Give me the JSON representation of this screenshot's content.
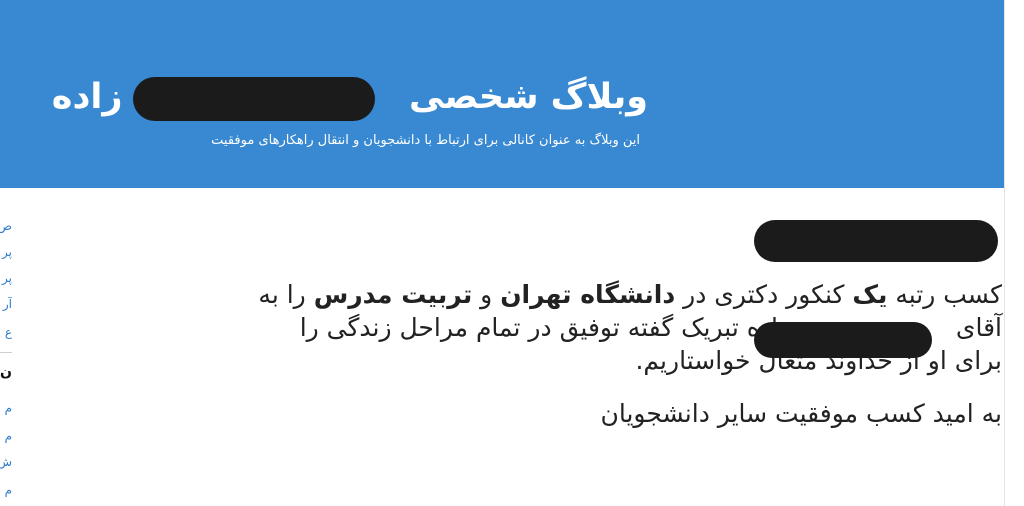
{
  "header": {
    "title_prefix": "وبلاگ شخصی",
    "title_suffix": "زاده",
    "tagline": "این وبلاگ به عنوان کانالی برای ارتباط با دانشجویان و انتقال راهکارهای موفقیت"
  },
  "sidebar": {
    "items": [
      "ص",
      "پر",
      "پر",
      "آر",
      "ع"
    ],
    "heading": "ن",
    "sub_items": [
      "م",
      "م",
      "ش",
      "م"
    ]
  },
  "post": {
    "line1": {
      "t1": "کسب رتبه",
      "b1": "یک",
      "t2": "کنکور دکتری در",
      "b2": "دانشگاه تهران",
      "t3": "و",
      "b3": "تربیت مدرس",
      "t4": "را به"
    },
    "line2": "آقای",
    "line2_rest": "زاده تبریک گفته توفیق در تمام مراحل زندگی را",
    "line3": "برای او از خداوند متعال خواستاریم.",
    "closing": "به امید کسب موفقیت سایر دانشجویان"
  },
  "colors": {
    "header_bg": "#3889d1",
    "link": "#2f7bc8",
    "redaction": "#1b1b1b"
  }
}
